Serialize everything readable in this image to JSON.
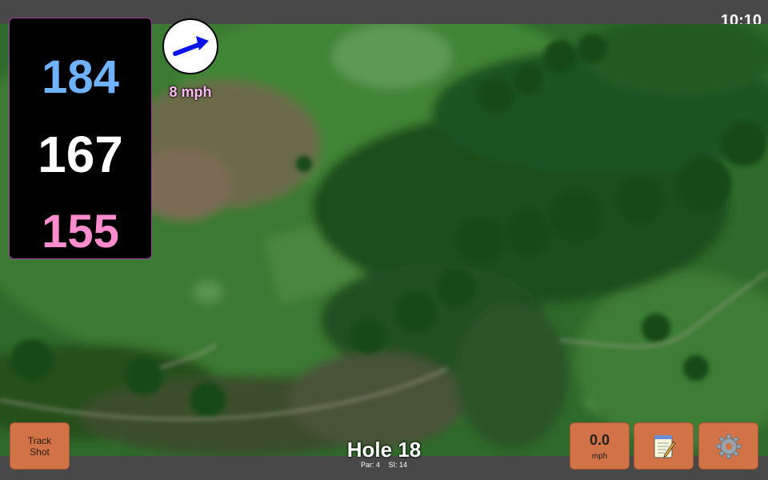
{
  "status_bar": {
    "time": "10:10"
  },
  "distances": {
    "back": "184",
    "middle": "167",
    "front": "155",
    "colors": {
      "back": "#6fb2ff",
      "middle": "#ffffff",
      "front": "#ff8ccf"
    }
  },
  "wind": {
    "speed": "8 mph",
    "direction_icon": "arrow-icon",
    "speed_color": "#ffb8f0",
    "arrow_color": "#0a14e6"
  },
  "hole": {
    "title": "Hole 18",
    "par": "Par: 4",
    "stroke_index": "SI: 14"
  },
  "buttons": {
    "track_shot_line1": "Track",
    "track_shot_line2": "Shot",
    "speed_value": "0.0",
    "speed_unit": "mph",
    "notes_icon": "notepad-icon",
    "settings_icon": "gear-icon",
    "color": "#d17346"
  }
}
